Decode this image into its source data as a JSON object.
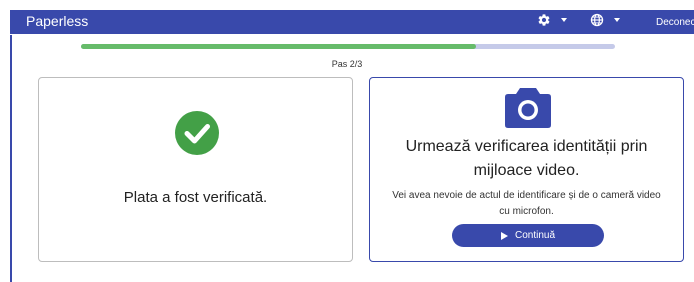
{
  "header": {
    "brand": "Paperless",
    "settings_icon": "gear-icon",
    "language_icon": "globe-icon",
    "logout_label": "Deconectare",
    "color": "#3949ab"
  },
  "progress": {
    "step_label": "Pas 2/3",
    "fraction": 0.74,
    "fill_color": "#66bb6a",
    "track_color": "#c5cae9"
  },
  "payment_card": {
    "icon": "check-circle-icon",
    "text": "Plata a fost verificată."
  },
  "video_card": {
    "icon": "camera-icon",
    "title": "Urmează verificarea identității prin mijloace video.",
    "subtitle": "Vei avea nevoie de actul de identificare și de o cameră video cu microfon.",
    "button_label": "Continuă",
    "button_icon": "play-icon"
  }
}
